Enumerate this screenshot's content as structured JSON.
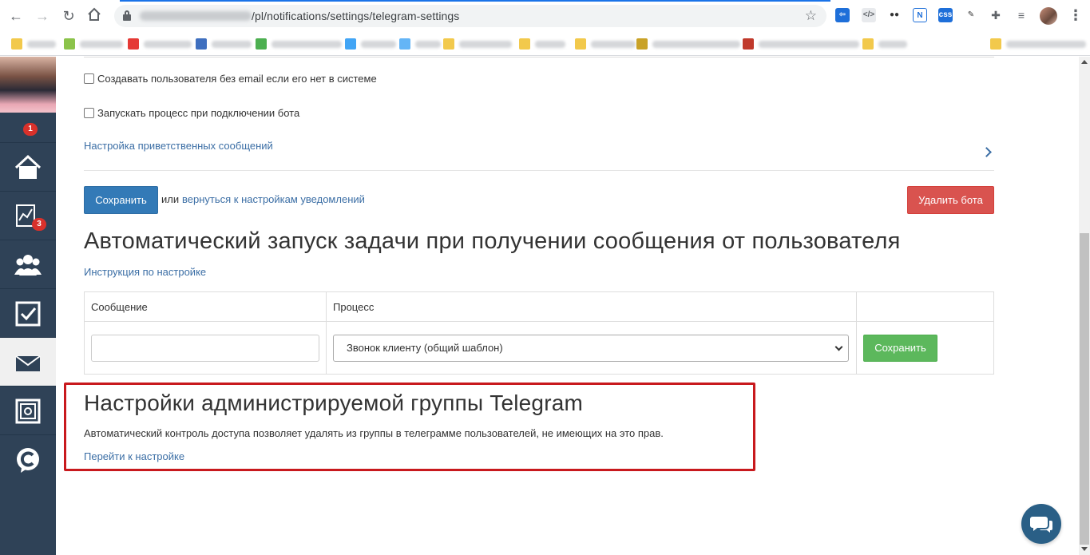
{
  "browser": {
    "url_path": "/pl/notifications/settings/telegram-settings",
    "profile_menu": "⋮"
  },
  "sidebar": {
    "notifications_badge": "1",
    "items": [
      {
        "icon": "home-icon"
      },
      {
        "icon": "chart-icon",
        "badge": "3"
      },
      {
        "icon": "users-icon"
      },
      {
        "icon": "tasks-icon"
      },
      {
        "icon": "mail-icon",
        "active": true
      },
      {
        "icon": "safe-icon"
      },
      {
        "icon": "getcourse-logo-icon"
      }
    ]
  },
  "form": {
    "checkbox_create_user": "Создавать пользователя без email если его нет в системе",
    "checkbox_start_process": "Запускать процесс при подключении бота",
    "welcome_messages_link": "Настройка приветственных сообщений",
    "save_button": "Сохранить",
    "or_text": "или",
    "back_link": "вернуться к настройкам уведомлений",
    "delete_bot_button": "Удалить бота"
  },
  "auto_launch": {
    "title": "Автоматический запуск задачи при получении сообщения от пользователя",
    "instruction_link": "Инструкция по настройке",
    "table": {
      "headers": [
        "Сообщение",
        "Процесс",
        ""
      ],
      "message_value": "",
      "process_selected": "Звонок клиенту (общий шаблон)",
      "save_button": "Сохранить"
    }
  },
  "group_settings": {
    "title": "Настройки администрируемой группы Telegram",
    "description": "Автоматический контроль доступа позволяет удалять из группы в телеграмме пользователей, не имеющих на это прав.",
    "link": "Перейти к настройке"
  },
  "colors": {
    "sidebar": "#2f4257",
    "primary": "#337ab7",
    "danger": "#d9534f",
    "success": "#5cb85c",
    "highlight": "#c8191d",
    "link": "#3b6ea5"
  }
}
